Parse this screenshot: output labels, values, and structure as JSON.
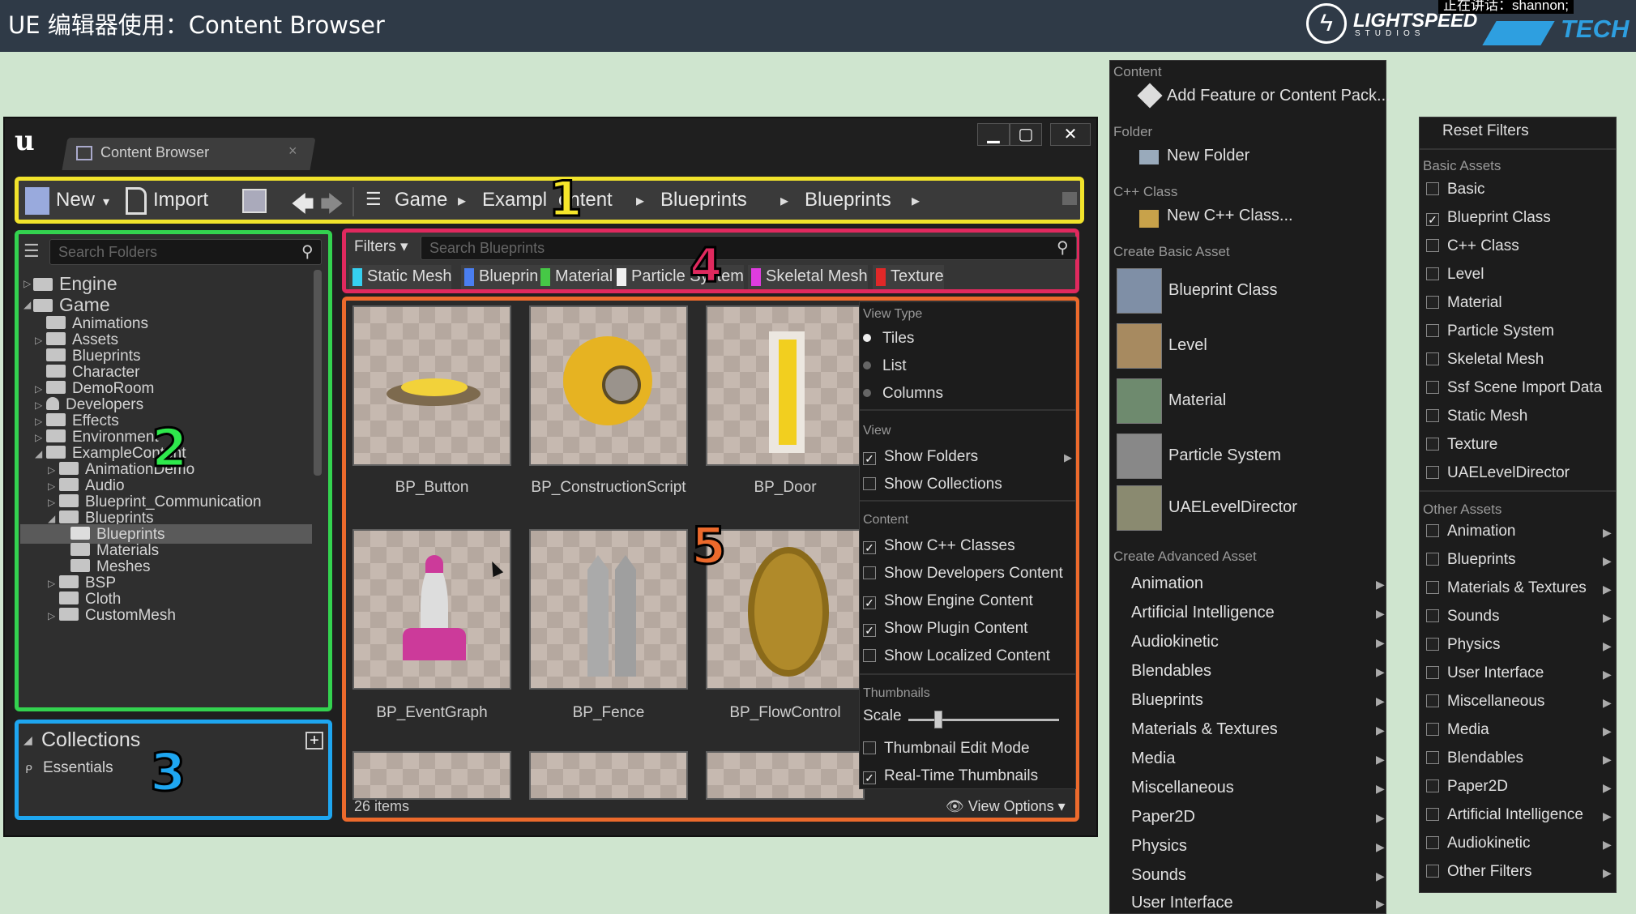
{
  "slide": {
    "title": "UE 编辑器使用：Content Browser",
    "top_right_name": "正在讲话：shannon;",
    "logo1": "LIGHTSPEED",
    "logo1_sub": "STUDIOS",
    "logo2": "TECH"
  },
  "window": {
    "tab_label": "Content Browser",
    "minimize": "▁",
    "maximize": "▢",
    "close": "✕"
  },
  "toolbar": {
    "new": "New",
    "import": "Import",
    "breadcrumb": [
      "Game",
      "Exampl",
      "ontent",
      "Blueprints",
      "Blueprints"
    ]
  },
  "markers": {
    "m1": "1",
    "m2": "2",
    "m3": "3",
    "m4": "4",
    "m5": "5"
  },
  "sidebar": {
    "search_placeholder": "Search Folders",
    "tree": [
      "Engine",
      "Game",
      "Animations",
      "Assets",
      "Blueprints",
      "Character",
      "DemoRoom",
      "Developers",
      "Effects",
      "Environment",
      "ExampleContent",
      "AnimationDemo",
      "Audio",
      "Blueprint_Communication",
      "Blueprints",
      "Blueprints",
      "Materials",
      "Meshes",
      "BSP",
      "Cloth",
      "CustomMesh"
    ]
  },
  "collections": {
    "title": "Collections",
    "items": [
      "Essentials"
    ]
  },
  "filters": {
    "label": "Filters",
    "search_placeholder": "Search Blueprints",
    "chips": [
      {
        "label": "Static Mesh",
        "color": "#35d0f0"
      },
      {
        "label": "Blueprint",
        "color": "#4a7ef0"
      },
      {
        "label": "Material",
        "color": "#46c846"
      },
      {
        "label": "Particle System",
        "color": "#f0f0f0"
      },
      {
        "label": "Skeletal Mesh",
        "color": "#e03ce0"
      },
      {
        "label": "Texture",
        "color": "#e02828"
      }
    ]
  },
  "assets": {
    "items": [
      "BP_Button",
      "BP_ConstructionScript",
      "BP_Door",
      "BP_EventGraph",
      "BP_Fence",
      "BP_FlowControl"
    ],
    "count": "26 items",
    "view_options": "View Options"
  },
  "view_options_menu": {
    "view_type_header": "View Type",
    "view_types": [
      {
        "label": "Tiles",
        "selected": true
      },
      {
        "label": "List",
        "selected": false
      },
      {
        "label": "Columns",
        "selected": false
      }
    ],
    "view_header": "View",
    "view_items": [
      {
        "label": "Show Folders",
        "checked": true
      },
      {
        "label": "Show Collections",
        "checked": false
      }
    ],
    "content_header": "Content",
    "content_items": [
      {
        "label": "Show C++ Classes",
        "checked": true
      },
      {
        "label": "Show Developers Content",
        "checked": false
      },
      {
        "label": "Show Engine Content",
        "checked": true
      },
      {
        "label": "Show Plugin Content",
        "checked": true
      },
      {
        "label": "Show Localized Content",
        "checked": false
      }
    ],
    "thumbnails_header": "Thumbnails",
    "scale_label": "Scale",
    "scale_value": 0.2,
    "thumb_items": [
      {
        "label": "Thumbnail Edit Mode",
        "checked": false
      },
      {
        "label": "Real-Time Thumbnails",
        "checked": true
      }
    ]
  },
  "add_menu": {
    "content_header": "Content",
    "add_feature": "Add Feature or Content Pack...",
    "folder_header": "Folder",
    "new_folder": "New Folder",
    "cpp_header": "C++ Class",
    "new_cpp": "New C++ Class...",
    "basic_header": "Create Basic Asset",
    "basic_assets": [
      "Blueprint Class",
      "Level",
      "Material",
      "Particle System",
      "UAELevelDirector"
    ],
    "advanced_header": "Create Advanced Asset",
    "advanced_assets": [
      "Animation",
      "Artificial Intelligence",
      "Audiokinetic",
      "Blendables",
      "Blueprints",
      "Materials & Textures",
      "Media",
      "Miscellaneous",
      "Paper2D",
      "Physics",
      "Sounds",
      "User Interface"
    ]
  },
  "filter_menu": {
    "reset": "Reset Filters",
    "basic_header": "Basic Assets",
    "basic": [
      {
        "label": "Basic",
        "checked": false
      },
      {
        "label": "Blueprint Class",
        "checked": true
      },
      {
        "label": "C++ Class",
        "checked": false
      },
      {
        "label": "Level",
        "checked": false
      },
      {
        "label": "Material",
        "checked": false
      },
      {
        "label": "Particle System",
        "checked": false
      },
      {
        "label": "Skeletal Mesh",
        "checked": false
      },
      {
        "label": "Ssf Scene Import Data",
        "checked": false
      },
      {
        "label": "Static Mesh",
        "checked": false
      },
      {
        "label": "Texture",
        "checked": false
      },
      {
        "label": "UAELevelDirector",
        "checked": false
      }
    ],
    "other_header": "Other Assets",
    "other": [
      "Animation",
      "Blueprints",
      "Materials & Textures",
      "Sounds",
      "Physics",
      "User Interface",
      "Miscellaneous",
      "Media",
      "Blendables",
      "Paper2D",
      "Artificial Intelligence",
      "Audiokinetic",
      "Other Filters"
    ]
  }
}
